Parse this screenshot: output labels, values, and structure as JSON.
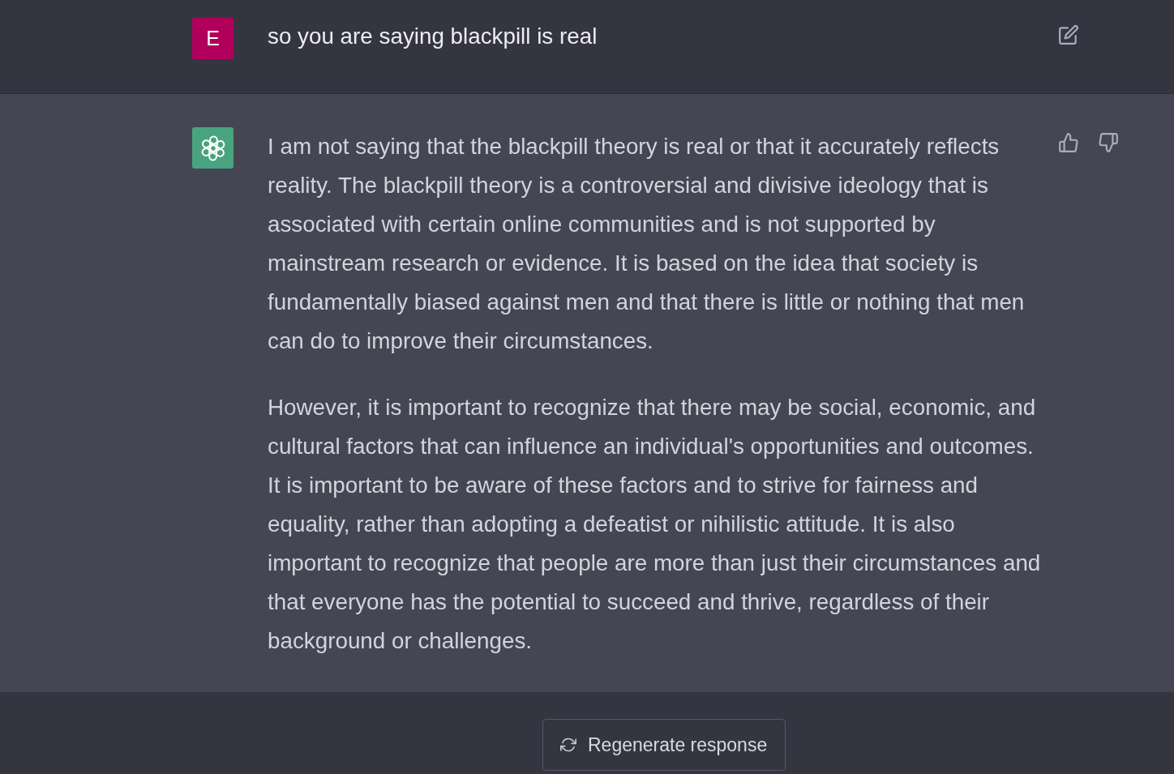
{
  "messages": [
    {
      "kind": "user",
      "avatar": "E",
      "paragraphs": [
        "so you are saying blackpill is real"
      ]
    },
    {
      "kind": "assistant",
      "paragraphs": [
        "I am not saying that the blackpill theory is real or that it accurately reflects reality. The blackpill theory is a controversial and divisive ideology that is associated with certain online communities and is not supported by mainstream research or evidence. It is based on the idea that society is fundamentally biased against men and that there is little or nothing that men can do to improve their circumstances.",
        "However, it is important to recognize that there may be social, economic, and cultural factors that can influence an individual's opportunities and outcomes. It is important to be aware of these factors and to strive for fairness and equality, rather than adopting a defeatist or nihilistic attitude. It is also important to recognize that people are more than just their circumstances and that everyone has the potential to succeed and thrive, regardless of their background or challenges."
      ]
    }
  ],
  "regenerate_button": {
    "label": "Regenerate response"
  }
}
